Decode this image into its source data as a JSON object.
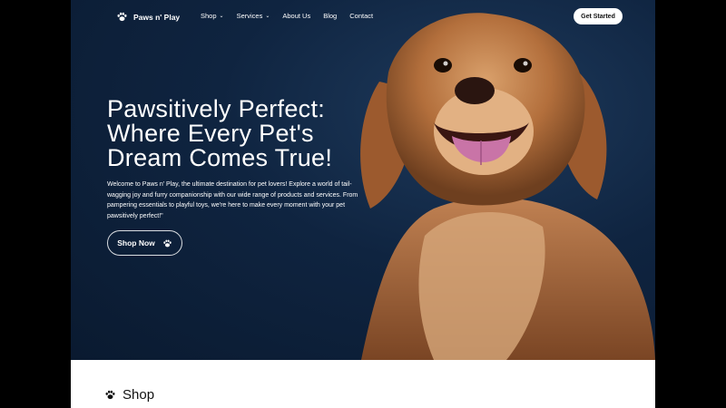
{
  "nav": {
    "brand": "Paws n' Play",
    "items": [
      {
        "label": "Shop",
        "dropdown": true
      },
      {
        "label": "Services",
        "dropdown": true
      },
      {
        "label": "About Us",
        "dropdown": false
      },
      {
        "label": "Blog",
        "dropdown": false
      },
      {
        "label": "Contact",
        "dropdown": false
      }
    ],
    "cta": "Get Started"
  },
  "hero": {
    "headline": "Pawsitively Perfect:\nWhere Every Pet's\nDream Comes True!",
    "description": "Welcome to Paws n' Play, the ultimate destination for pet lovers! Explore a world of tail-wagging joy and furry companionship with our wide range of products and services. From pampering essentials to playful toys, we're here to make every moment with your pet pawsitively perfect!\"",
    "button": "Shop Now"
  },
  "shop": {
    "title": "Shop"
  },
  "icons": {
    "paw": "paw-icon",
    "chevron": "chevron-down-icon"
  },
  "colors": {
    "hero_bg": "#0f2440",
    "text_light": "#ffffff",
    "page_bg": "#000000"
  }
}
